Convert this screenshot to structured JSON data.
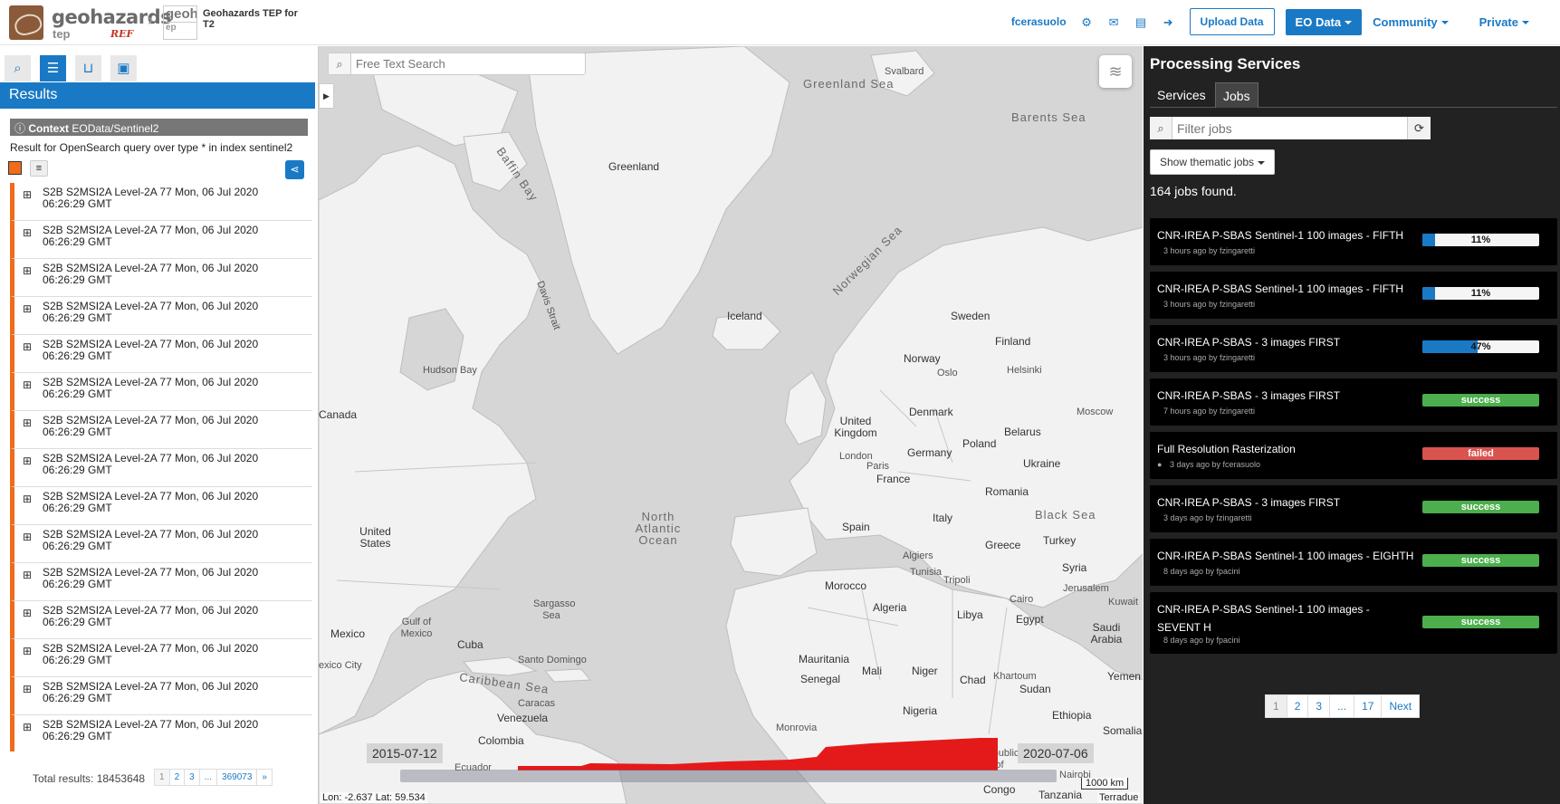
{
  "header": {
    "logo_name": "geohazards",
    "logo_sub": "tep",
    "logo_ref": "REF",
    "small_logo_line1": "geoh",
    "small_logo_line2": "ep",
    "tep_title": "Geohazards TEP for T2",
    "user": "fcerasuolo",
    "upload_label": "Upload Data",
    "eodata_label": "EO Data",
    "community_label": "Community",
    "private_label": "Private",
    "accent_color": "#1a79c5"
  },
  "left": {
    "results_title": "Results",
    "context_label": "Context",
    "context_value": "EOData/Sentinel2",
    "context_desc": "Result for OpenSearch query over type * in index sentinel2",
    "results": [
      {
        "title": "S2B S2MSI2A Level-2A 77 Mon, 06 Jul 2020 06:26:29 GMT"
      },
      {
        "title": "S2B S2MSI2A Level-2A 77 Mon, 06 Jul 2020 06:26:29 GMT"
      },
      {
        "title": "S2B S2MSI2A Level-2A 77 Mon, 06 Jul 2020 06:26:29 GMT"
      },
      {
        "title": "S2B S2MSI2A Level-2A 77 Mon, 06 Jul 2020 06:26:29 GMT"
      },
      {
        "title": "S2B S2MSI2A Level-2A 77 Mon, 06 Jul 2020 06:26:29 GMT"
      },
      {
        "title": "S2B S2MSI2A Level-2A 77 Mon, 06 Jul 2020 06:26:29 GMT"
      },
      {
        "title": "S2B S2MSI2A Level-2A 77 Mon, 06 Jul 2020 06:26:29 GMT"
      },
      {
        "title": "S2B S2MSI2A Level-2A 77 Mon, 06 Jul 2020 06:26:29 GMT"
      },
      {
        "title": "S2B S2MSI2A Level-2A 77 Mon, 06 Jul 2020 06:26:29 GMT"
      },
      {
        "title": "S2B S2MSI2A Level-2A 77 Mon, 06 Jul 2020 06:26:29 GMT"
      },
      {
        "title": "S2B S2MSI2A Level-2A 77 Mon, 06 Jul 2020 06:26:29 GMT"
      },
      {
        "title": "S2B S2MSI2A Level-2A 77 Mon, 06 Jul 2020 06:26:29 GMT"
      },
      {
        "title": "S2B S2MSI2A Level-2A 77 Mon, 06 Jul 2020 06:26:29 GMT"
      },
      {
        "title": "S2B S2MSI2A Level-2A 77 Mon, 06 Jul 2020 06:26:29 GMT"
      },
      {
        "title": "S2B S2MSI2A Level-2A 77 Mon, 06 Jul 2020 06:26:29 GMT"
      }
    ],
    "total_label": "Total results: 18453648",
    "pager": [
      "1",
      "2",
      "3",
      "...",
      "369073",
      "»"
    ],
    "result_color": "#f06b1a"
  },
  "map": {
    "search_placeholder": "Free Text Search",
    "timeline_start": "2015-07-12",
    "timeline_end": "2020-07-06",
    "scale": "1000 km",
    "coords": "Lon: -2.637 Lat: 59.534",
    "attribution": "Terradue",
    "labels": {
      "greenland_sea": "Greenland Sea",
      "svalbard": "Svalbard",
      "barents_sea": "Barents Sea",
      "greenland": "Greenland",
      "baffin_bay": "Baffin Bay",
      "norwegian_sea": "Norwegian Sea",
      "davis_strait": "Davis Strait",
      "iceland": "Iceland",
      "sweden": "Sweden",
      "finland": "Finland",
      "norway": "Norway",
      "oslo": "Oslo",
      "helsinki": "Helsinki",
      "hudson_bay": "Hudson Bay",
      "canada": "Canada",
      "denmark": "Denmark",
      "moscow": "Moscow",
      "united_kingdom": "United Kingdom",
      "london": "London",
      "poland": "Poland",
      "belarus": "Belarus",
      "germany": "Germany",
      "ukraine": "Ukraine",
      "paris": "Paris",
      "france": "France",
      "romania": "Romania",
      "black_sea": "Black Sea",
      "italy": "Italy",
      "spain": "Spain",
      "greece": "Greece",
      "turkey": "Turkey",
      "north_atlantic": "North Atlantic Ocean",
      "united_states": "United States",
      "algiers": "Algiers",
      "tunisia": "Tunisia",
      "tripoli": "Tripoli",
      "syria": "Syria",
      "jerusalem": "Jerusalem",
      "morocco": "Morocco",
      "algeria": "Algeria",
      "libya": "Libya",
      "egypt": "Egypt",
      "cairo": "Cairo",
      "kuwait": "Kuwait",
      "saudi_arabia": "Saudi Arabia",
      "sargasso_sea": "Sargasso Sea",
      "gulf_of_mexico": "Gulf of Mexico",
      "mexico": "Mexico",
      "cuba": "Cuba",
      "mauritania": "Mauritania",
      "mali": "Mali",
      "niger": "Niger",
      "chad": "Chad",
      "sudan": "Sudan",
      "khartoum": "Khartoum",
      "yemen": "Yemen",
      "santo_domingo": "Santo Domingo",
      "mexico_city": "exico City",
      "caribbean_sea": "Caribbean Sea",
      "senegal": "Senegal",
      "nigeria": "Nigeria",
      "ethiopia": "Ethiopia",
      "caracas": "Caracas",
      "venezuela": "Venezuela",
      "monrovia": "Monrovia",
      "colombia": "Colombia",
      "somalia": "Somalia",
      "ecuador": "Ecuador",
      "republic": "Republic of",
      "nairobi": "Nairobi",
      "congo": "Congo",
      "tanzania": "Tanzania"
    }
  },
  "processing": {
    "title": "Processing Services",
    "tabs": [
      "Services",
      "Jobs"
    ],
    "filter_placeholder": "Filter jobs",
    "thematic_label": "Show thematic jobs",
    "jobs_count": "164 jobs found.",
    "jobs": [
      {
        "title": "CNR-IREA P-SBAS Sentinel-1 100 images - FIFTH",
        "meta": "3 hours ago by fzingaretti",
        "status": "11%",
        "kind": "progress",
        "progress": 0.11
      },
      {
        "title": "CNR-IREA P-SBAS Sentinel-1 100 images - FIFTH",
        "meta": "3 hours ago by fzingaretti",
        "status": "11%",
        "kind": "progress",
        "progress": 0.11
      },
      {
        "title": "CNR-IREA P-SBAS - 3 images FIRST",
        "meta": "3 hours ago by fzingaretti",
        "status": "47%",
        "kind": "progress",
        "progress": 0.47
      },
      {
        "title": "CNR-IREA P-SBAS - 3 images FIRST",
        "meta": "7 hours ago by fzingaretti",
        "status": "success",
        "kind": "success"
      },
      {
        "title": "Full Resolution Rasterization",
        "meta": "3 days ago by fcerasuolo",
        "status": "failed",
        "kind": "failed",
        "user_icon": true
      },
      {
        "title": "CNR-IREA P-SBAS - 3 images FIRST",
        "meta": "3 days ago by fzingaretti",
        "status": "success",
        "kind": "success"
      },
      {
        "title": "CNR-IREA P-SBAS Sentinel-1 100 images - EIGHTH",
        "meta": "8 days ago by fpacini",
        "status": "success",
        "kind": "success"
      },
      {
        "title": "CNR-IREA P-SBAS Sentinel-1 100 images - SEVENT H",
        "meta": "8 days ago by fpacini",
        "status": "success",
        "kind": "success",
        "tall": true
      }
    ],
    "pager": [
      "1",
      "2",
      "3",
      "...",
      "17",
      "Next"
    ]
  }
}
